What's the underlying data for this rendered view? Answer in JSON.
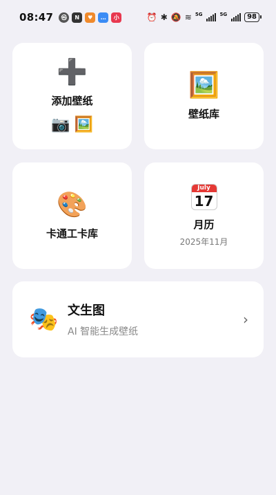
{
  "status_bar": {
    "time": "08:47",
    "battery": "98",
    "net1": "5G",
    "net2": "5G",
    "app_icons": [
      {
        "name": "nfc-app-icon",
        "glyph": "N",
        "color": "#333333"
      },
      {
        "name": "orange-app-icon",
        "glyph": "♥",
        "color": "#f08a2c"
      },
      {
        "name": "message-app-icon",
        "glyph": "…",
        "color": "#3b8cf5"
      },
      {
        "name": "red-app-icon",
        "glyph": "小",
        "color": "#e8384f"
      }
    ]
  },
  "cards": {
    "add": {
      "title": "添加壁纸",
      "icon": "➕",
      "mini1": "📷",
      "mini2": "🖼️"
    },
    "library": {
      "title": "壁纸库",
      "icon": "🖼️"
    },
    "cartoon": {
      "title": "卡通工卡库",
      "icon": "🎨"
    },
    "calendar": {
      "title": "月历",
      "subtitle": "2025年11月",
      "month": "July",
      "day": "17"
    }
  },
  "ai_card": {
    "icon": "🎭",
    "title": "文生图",
    "subtitle": "AI 智能生成壁纸",
    "chevron": "›"
  }
}
